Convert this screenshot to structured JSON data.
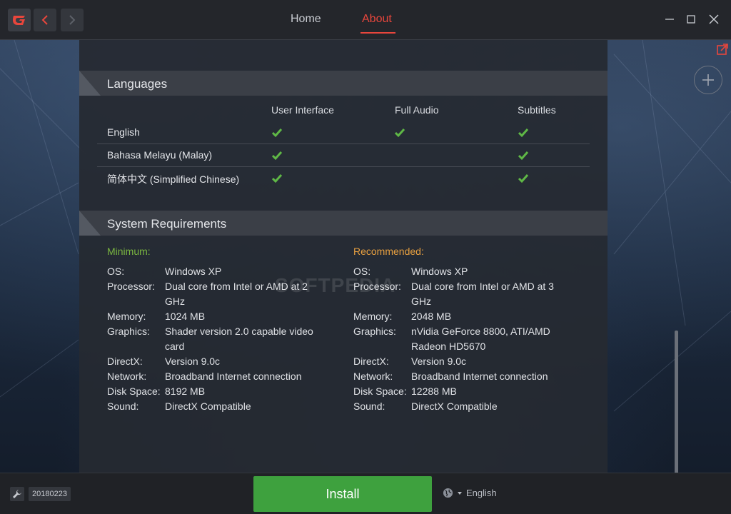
{
  "titlebar": {
    "tabs": [
      {
        "label": "Home",
        "active": false
      },
      {
        "label": "About",
        "active": true
      }
    ]
  },
  "languages": {
    "title": "Languages",
    "columns": [
      "User Interface",
      "Full Audio",
      "Subtitles"
    ],
    "rows": [
      {
        "name": "English",
        "ui": true,
        "audio": true,
        "subtitles": true
      },
      {
        "name": "Bahasa Melayu (Malay)",
        "ui": true,
        "audio": false,
        "subtitles": true
      },
      {
        "name": "简体中文 (Simplified Chinese)",
        "ui": true,
        "audio": false,
        "subtitles": true
      }
    ]
  },
  "requirements": {
    "title": "System Requirements",
    "minimum": {
      "title": "Minimum:",
      "os_label": "OS:",
      "os": "Windows XP",
      "cpu_label": "Processor:",
      "cpu_1": "Dual core from Intel or AMD at 2",
      "cpu_2": "GHz",
      "mem_label": "Memory:",
      "mem": "1024 MB",
      "gfx_label": "Graphics:",
      "gfx_1": "Shader version 2.0 capable video",
      "gfx_2": "card",
      "dx_label": "DirectX:",
      "dx": "Version 9.0c",
      "net_label": "Network:",
      "net": "Broadband Internet connection",
      "disk_label": "Disk Space:",
      "disk": "8192 MB",
      "sound_label": "Sound:",
      "sound": "DirectX Compatible"
    },
    "recommended": {
      "title": "Recommended:",
      "os_label": "OS:",
      "os": "Windows XP",
      "cpu_label": "Processor:",
      "cpu_1": "Dual core from Intel or AMD at 3",
      "cpu_2": "GHz",
      "mem_label": "Memory:",
      "mem": "2048 MB",
      "gfx_label": "Graphics:",
      "gfx_1": "nVidia GeForce 8800, ATI/AMD",
      "gfx_2": "Radeon HD5670",
      "dx_label": "DirectX:",
      "dx": "Version 9.0c",
      "net_label": "Network:",
      "net": "Broadband Internet connection",
      "disk_label": "Disk Space:",
      "disk": "12288 MB",
      "sound_label": "Sound:",
      "sound": "DirectX Compatible"
    }
  },
  "watermark": "SOFTPEDIA",
  "footer": {
    "version": "20180223",
    "install_label": "Install",
    "language": "English"
  },
  "colors": {
    "accent_red": "#e8463c",
    "install_green": "#3ea13e",
    "check_green": "#5fb846",
    "minimum_green": "#7ab640",
    "recommended_orange": "#e8a040"
  }
}
